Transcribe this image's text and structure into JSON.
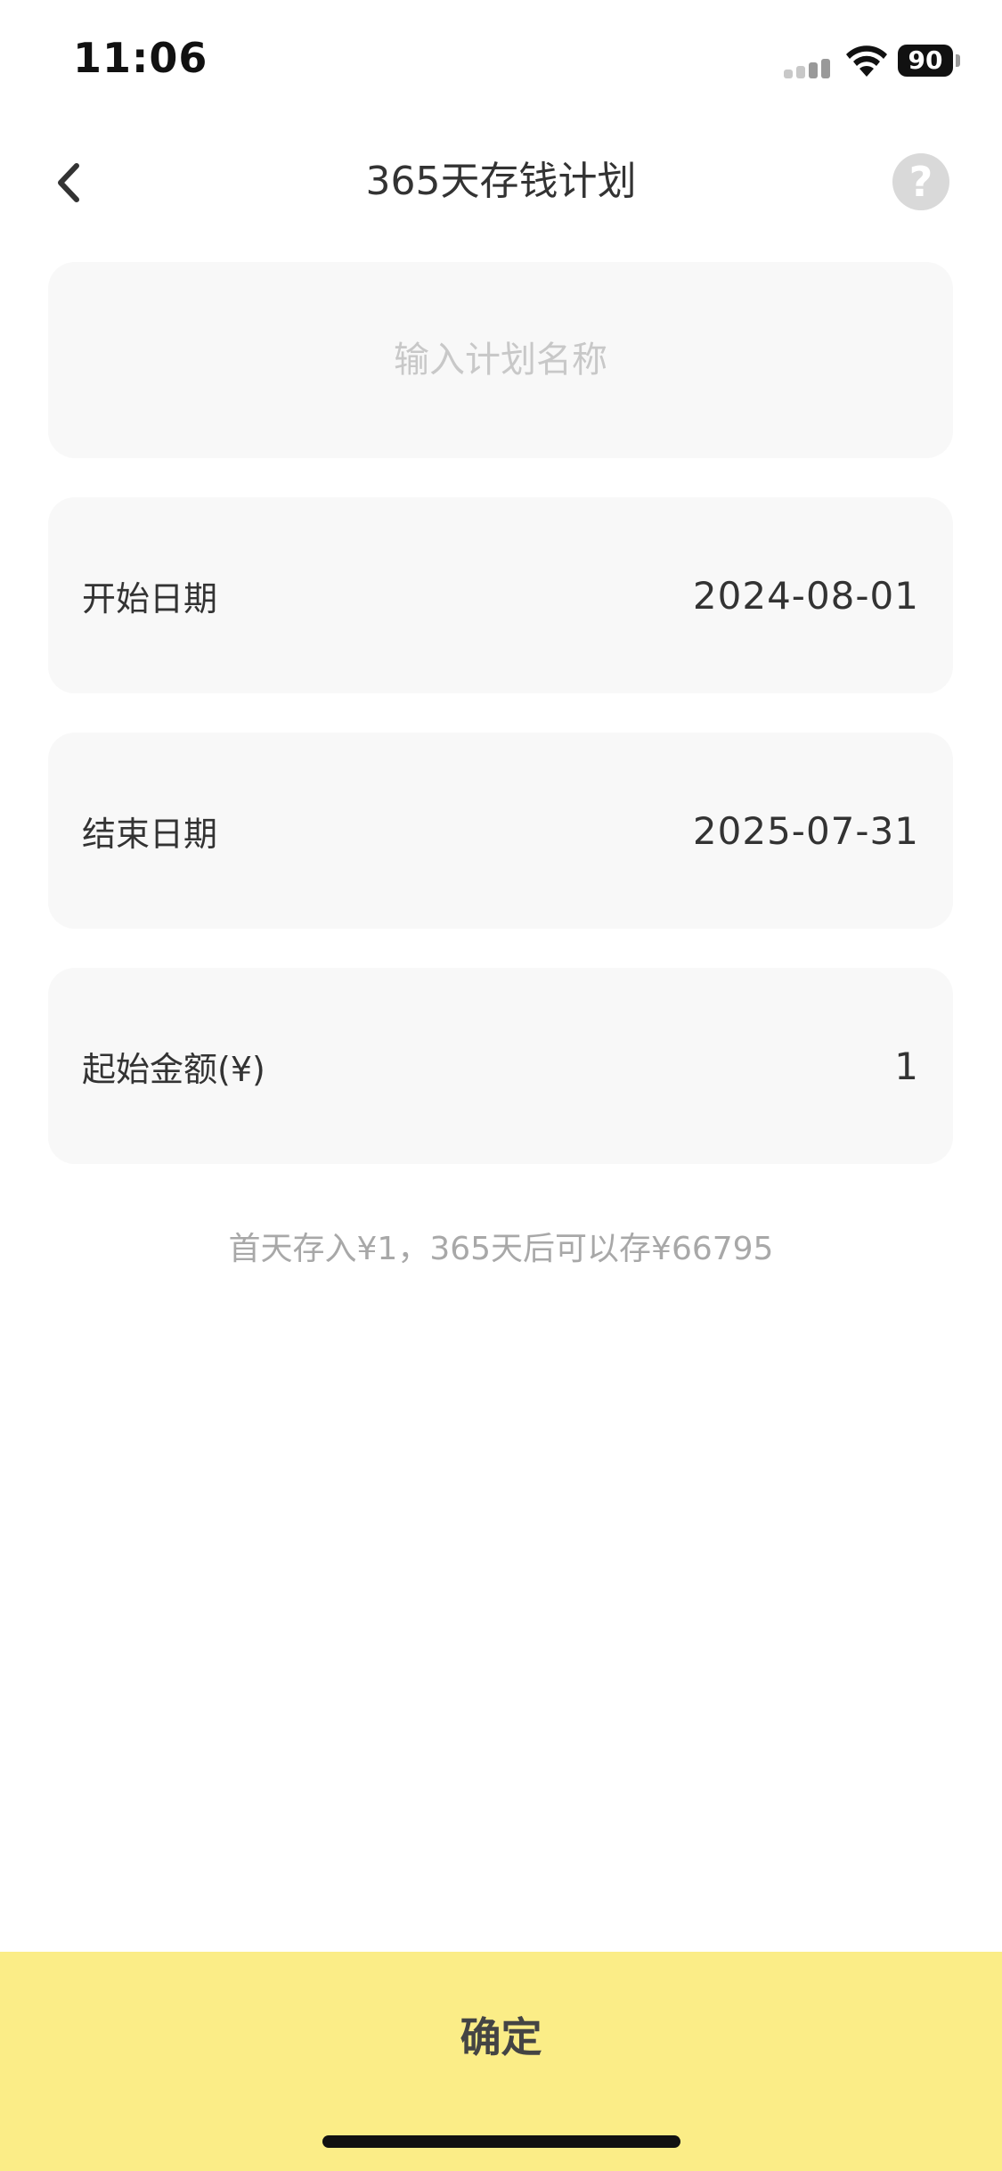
{
  "status_bar": {
    "time": "11:06",
    "battery_level": "90",
    "signal_icon": "cellular-signal-icon",
    "wifi_icon": "wifi-icon",
    "battery_icon": "battery-icon"
  },
  "nav": {
    "title": "365天存钱计划",
    "back_icon": "chevron-left-icon",
    "help_icon": "question-mark-icon",
    "help_glyph": "?"
  },
  "form": {
    "plan_name": {
      "placeholder": "输入计划名称",
      "value": ""
    },
    "start_date": {
      "label": "开始日期",
      "value": "2024-08-01"
    },
    "end_date": {
      "label": "结束日期",
      "value": "2025-07-31"
    },
    "start_amount": {
      "label": "起始金额(¥)",
      "value": "1"
    }
  },
  "summary": "首天存入¥1，365天后可以存¥66795",
  "confirm_button": {
    "label": "确定"
  },
  "colors": {
    "accent": "#fbed87",
    "card_bg": "#f8f8f8",
    "text_primary": "#333333",
    "text_muted": "#a8a8a8",
    "help_bg": "#d9d9d9"
  }
}
